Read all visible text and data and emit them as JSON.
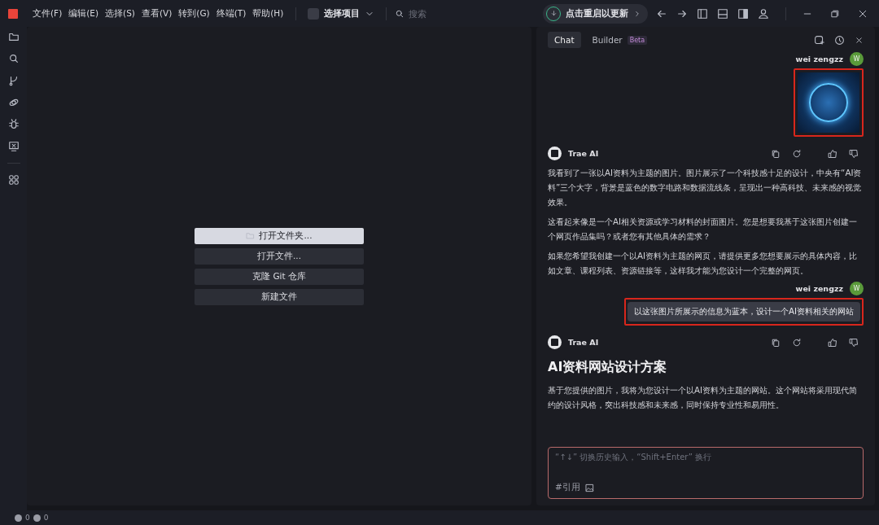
{
  "menu": {
    "items": [
      "文件(F)",
      "编辑(E)",
      "选择(S)",
      "查看(V)",
      "转到(G)",
      "终端(T)",
      "帮助(H)"
    ]
  },
  "project": {
    "label": "选择项目"
  },
  "search": {
    "placeholder": "搜索"
  },
  "update": {
    "label": "点击重启以更新"
  },
  "editor": {
    "buttons": [
      {
        "label": "打开文件夹...",
        "kind": "primary"
      },
      {
        "label": "打开文件...",
        "kind": "secondary"
      },
      {
        "label": "克隆 Git 仓库",
        "kind": "secondary"
      },
      {
        "label": "新建文件",
        "kind": "secondary"
      }
    ]
  },
  "chat": {
    "tabs": [
      {
        "label": "Chat",
        "selected": true
      },
      {
        "label": "Builder",
        "selected": false,
        "badge": "Beta"
      }
    ],
    "messages": [
      {
        "kind": "user_image",
        "author": "wei zengzz",
        "avatar": "W",
        "highlighted": true
      },
      {
        "kind": "ai",
        "author": "Trae AI",
        "paragraphs": [
          "我看到了一张以AI资料为主题的图片。图片展示了一个科技感十足的设计，中央有“AI资料”三个大字，背景是蓝色的数字电路和数据流线条，呈现出一种高科技、未来感的视觉效果。",
          "这看起来像是一个AI相关资源或学习材料的封面图片。您是想要我基于这张图片创建一个网页作品集吗？或者您有其他具体的需求？",
          "如果您希望我创建一个以AI资料为主题的网页，请提供更多您想要展示的具体内容，比如文章、课程列表、资源链接等，这样我才能为您设计一个完整的网页。"
        ]
      },
      {
        "kind": "user_text",
        "author": "wei zengzz",
        "avatar": "W",
        "text": "以这张图片所展示的信息为蓝本，设计一个AI资料相关的网站",
        "highlighted": true
      },
      {
        "kind": "ai",
        "author": "Trae AI",
        "heading": "AI资料网站设计方案",
        "paragraphs": [
          "基于您提供的图片，我将为您设计一个以AI资料为主题的网站。这个网站将采用现代简约的设计风格，突出科技感和未来感，同时保持专业性和易用性。"
        ]
      }
    ],
    "input": {
      "placeholder": "“↑↓” 切换历史输入，“Shift+Enter” 换行",
      "reference": "#引用"
    }
  },
  "status_bar": {
    "errors": "0",
    "warnings": "0"
  }
}
